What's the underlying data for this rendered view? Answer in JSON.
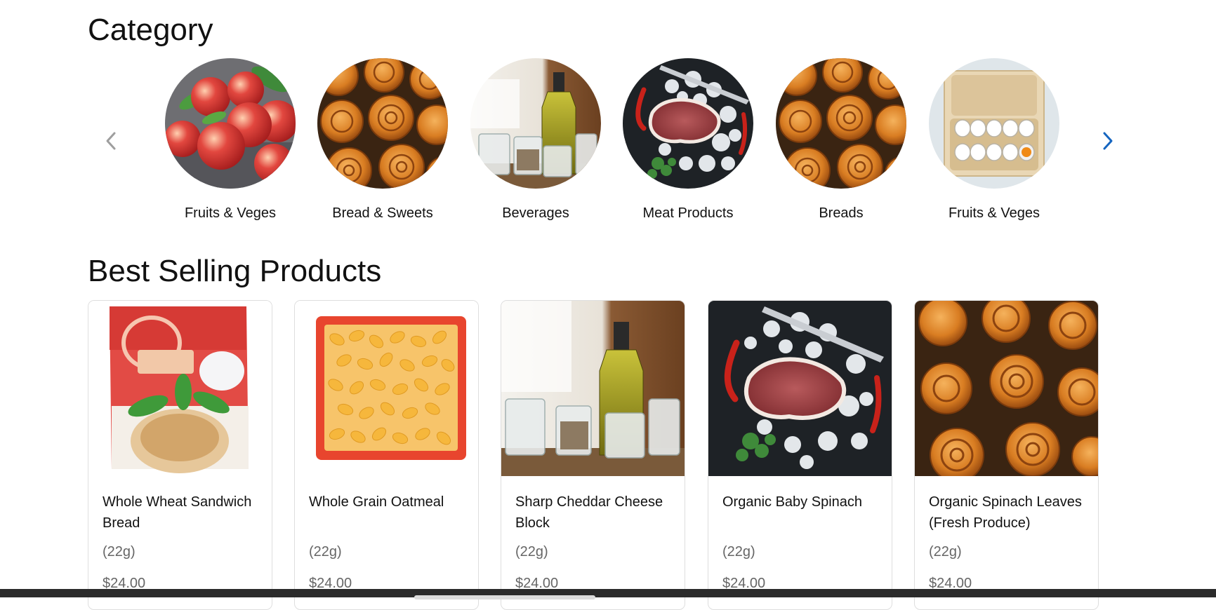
{
  "category": {
    "title": "Category",
    "prev_icon": "chevron-left-icon",
    "next_icon": "chevron-right-icon",
    "items": [
      {
        "label": "Fruits & Veges",
        "image": "apples"
      },
      {
        "label": "Bread & Sweets",
        "image": "cinnamon-rolls"
      },
      {
        "label": "Beverages",
        "image": "oil-bottle"
      },
      {
        "label": "Meat Products",
        "image": "steak"
      },
      {
        "label": "Breads",
        "image": "cinnamon-rolls"
      },
      {
        "label": "Fruits & Veges",
        "image": "eggs"
      }
    ]
  },
  "best_selling": {
    "title": "Best Selling Products",
    "products": [
      {
        "name": "Whole Wheat Sandwich Bread",
        "weight": "(22g)",
        "price": "$24.00",
        "image": "bread-bag"
      },
      {
        "name": "Whole Grain Oatmeal",
        "weight": "(22g)",
        "price": "$24.00",
        "image": "grains-tray"
      },
      {
        "name": "Sharp Cheddar Cheese Block",
        "weight": "(22g)",
        "price": "$24.00",
        "image": "oil-bottle"
      },
      {
        "name": "Organic Baby Spinach",
        "weight": "(22g)",
        "price": "$24.00",
        "image": "steak"
      },
      {
        "name": "Organic Spinach Leaves (Fresh Produce)",
        "weight": "(22g)",
        "price": "$24.00",
        "image": "cinnamon-rolls"
      }
    ]
  },
  "colors": {
    "accent": "#1565c0",
    "disabled_arrow": "#9e9e9e",
    "muted_text": "#666666",
    "card_border": "#dedede"
  }
}
